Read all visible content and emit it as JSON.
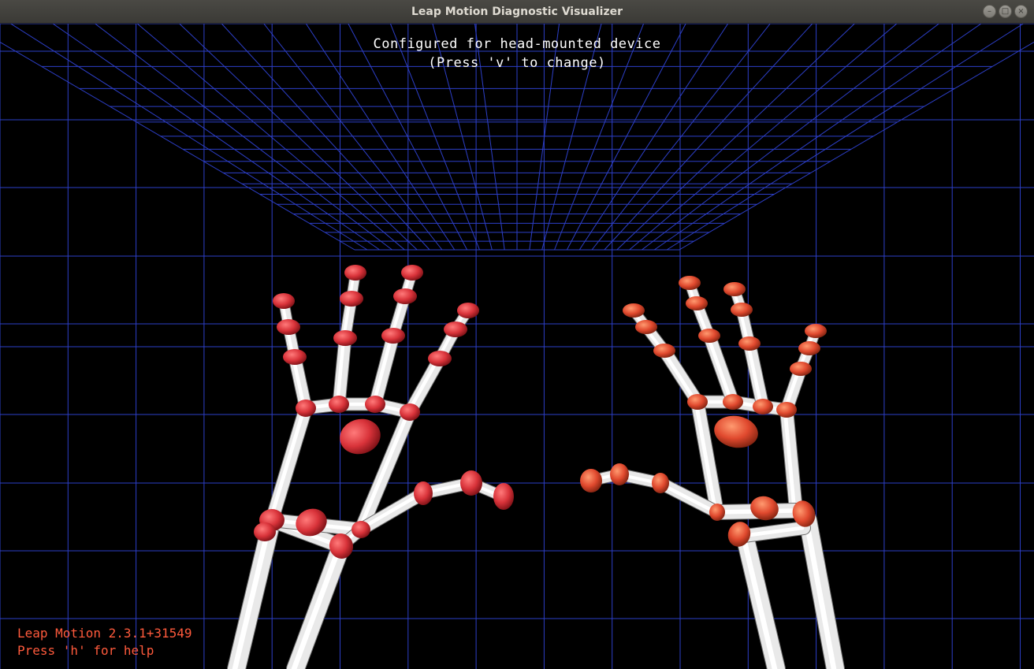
{
  "window": {
    "title": "Leap Motion Diagnostic Visualizer",
    "controls": {
      "minimize": "–",
      "maximize": "□",
      "close": "×"
    }
  },
  "overlay": {
    "config_message": "Configured for head-mounted device",
    "change_hint": "(Press 'v' to change)",
    "version": "Leap Motion 2.3.1+31549",
    "help_hint": "Press 'h' for help"
  },
  "colors": {
    "grid": "#2d3fc8",
    "joint_left": "#d9333a",
    "joint_right": "#e0492e",
    "bone": "#e8e8e8",
    "overlay_text": "#ffffff",
    "info_text": "#ff5a3c"
  },
  "scene": {
    "hands": [
      {
        "name": "left-hand",
        "label": ""
      },
      {
        "name": "right-hand",
        "label": ""
      }
    ]
  }
}
